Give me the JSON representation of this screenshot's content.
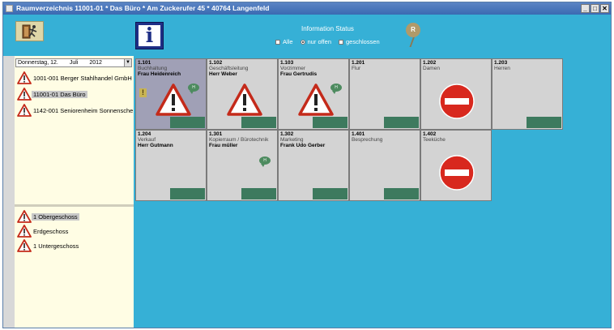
{
  "window": {
    "title": "Raumverzeichnis 11001-01 * Das Büro * Am Zuckerufer 45 * 40764 Langenfeld",
    "buttons": [
      "_",
      "□",
      "✕"
    ]
  },
  "toolbar": {
    "info_glyph": "i",
    "status": {
      "title": "Information Status",
      "options": [
        {
          "label": "Alle",
          "checked": false
        },
        {
          "label": "nur offen",
          "checked": true
        },
        {
          "label": "geschlossen",
          "checked": false
        }
      ],
      "badge": "R"
    }
  },
  "sidebar": {
    "date": {
      "day": "Donnerstag, 12.",
      "month": "Juli",
      "year": "2012"
    },
    "buildings": [
      {
        "label": "1001-001 Berger Stahlhandel GmbH",
        "selected": false
      },
      {
        "label": "11001-01 Das Büro",
        "selected": true
      },
      {
        "label": "1142-001 Seniorenheim Sonnenschein",
        "selected": false
      }
    ],
    "floors": [
      {
        "label": "1 Obergeschoss",
        "selected": true
      },
      {
        "label": "Erdgeschoss",
        "selected": false
      },
      {
        "label": "1 Untergeschoss",
        "selected": false
      }
    ]
  },
  "rooms": [
    {
      "number": "1.101",
      "dept": "Buchhaltung",
      "person": "Frau Heidenreich",
      "status": "warning",
      "selected": true,
      "note": "H",
      "flag": "!",
      "footbar": true
    },
    {
      "number": "1.102",
      "dept": "Geschäftsleitung",
      "person": "Herr Weber",
      "status": "warning",
      "selected": false,
      "note": "",
      "flag": "",
      "footbar": true
    },
    {
      "number": "1.103",
      "dept": "Vorzimmer",
      "person": "Frau Gertrudis",
      "status": "warning",
      "selected": false,
      "note": "H",
      "flag": "",
      "footbar": true
    },
    {
      "number": "1.201",
      "dept": "Flur",
      "person": "",
      "status": "none",
      "selected": false,
      "note": "",
      "flag": "",
      "footbar": true
    },
    {
      "number": "1.202",
      "dept": "Damen",
      "person": "",
      "status": "closed",
      "selected": false,
      "note": "",
      "flag": "",
      "footbar": false
    },
    {
      "number": "1.203",
      "dept": "Herren",
      "person": "",
      "status": "none",
      "selected": false,
      "note": "",
      "flag": "",
      "footbar": true
    },
    {
      "number": "1.204",
      "dept": "Verkauf",
      "person": "Herr Gutmann",
      "status": "none",
      "selected": false,
      "note": "",
      "flag": "",
      "footbar": true
    },
    {
      "number": "1.301",
      "dept": "Kopierraum / Bürotechnik",
      "person": "Frau müller",
      "status": "none",
      "selected": false,
      "note": "H",
      "flag": "",
      "footbar": true
    },
    {
      "number": "1.302",
      "dept": "Marketing",
      "person": "Frank Udo Gerber",
      "status": "none",
      "selected": false,
      "note": "",
      "flag": "",
      "footbar": true
    },
    {
      "number": "1.401",
      "dept": "Besprechung",
      "person": "",
      "status": "none",
      "selected": false,
      "note": "",
      "flag": "",
      "footbar": true
    },
    {
      "number": "1.402",
      "dept": "Teeküche",
      "person": "",
      "status": "closed",
      "selected": false,
      "note": "",
      "flag": "",
      "footbar": false
    }
  ]
}
